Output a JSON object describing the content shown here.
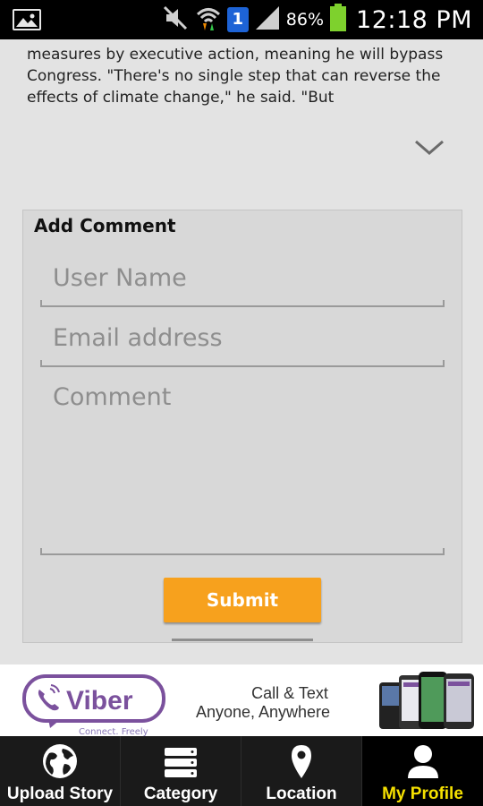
{
  "status_bar": {
    "battery_percent": "86%",
    "time": "12:18 PM",
    "sim_label": "1"
  },
  "article": {
    "text": "measures by executive action, meaning he will bypass Congress. \"There's no single step that can reverse the effects of climate change,\" he said. \"But"
  },
  "comment_form": {
    "title": "Add Comment",
    "username_placeholder": "User Name",
    "email_placeholder": "Email address",
    "comment_placeholder": "Comment",
    "submit_label": "Submit"
  },
  "ad": {
    "brand": "Viber",
    "slogan": "Connect. Freely",
    "line1": "Call & Text",
    "line2": "Anyone, Anywhere"
  },
  "bottom_nav": {
    "tabs": [
      {
        "label": "Upload Story",
        "icon": "globe-icon",
        "active": false
      },
      {
        "label": "Category",
        "icon": "list-icon",
        "active": false
      },
      {
        "label": "Location",
        "icon": "location-pin-icon",
        "active": false
      },
      {
        "label": "My Profile",
        "icon": "person-icon",
        "active": true
      }
    ]
  },
  "colors": {
    "accent": "#f7a11d",
    "active_tab_text": "#f5e000",
    "viber_purple": "#7b519d"
  }
}
